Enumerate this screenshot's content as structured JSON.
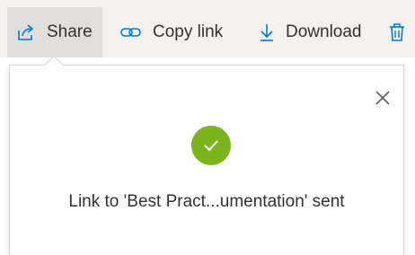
{
  "toolbar": {
    "share_label": "Share",
    "copy_link_label": "Copy link",
    "download_label": "Download",
    "icons": {
      "share": "share-icon",
      "copy_link": "link-icon",
      "download": "download-icon",
      "delete": "trash-icon"
    }
  },
  "callout": {
    "message": "Link to 'Best Pract...umentation' sent",
    "status_icon": "check-circle-icon",
    "close_icon": "close-icon",
    "success_color": "#7ab51d"
  },
  "colors": {
    "toolbar_bg": "#f3f2f1",
    "active_button_bg": "#e1dfdd",
    "accent": "#0078d4"
  }
}
